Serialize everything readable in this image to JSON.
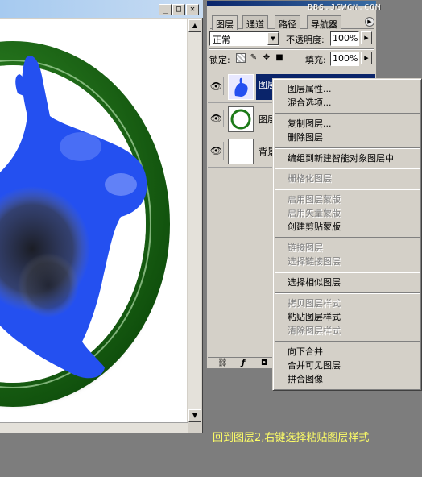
{
  "window_controls": {
    "minimize": "_",
    "maximize": "□",
    "close": "✕"
  },
  "watermark": "BBS.JCWCN.COM",
  "palette": {
    "tabs": [
      {
        "label": "图层",
        "active": true
      },
      {
        "label": "通道",
        "active": false
      },
      {
        "label": "路径",
        "active": false
      },
      {
        "label": "导航器",
        "active": false
      }
    ],
    "blend_mode": "正常",
    "opacity_label": "不透明度:",
    "opacity_value": "100%",
    "lock_label": "锁定:",
    "fill_label": "填充:",
    "fill_value": "100%",
    "layers": [
      {
        "name": "图层",
        "visible_icon": "eye-icon",
        "thumb": "rabbit-thumb",
        "selected": true
      },
      {
        "name": "图层",
        "visible_icon": "eye-icon",
        "thumb": "ring-thumb",
        "selected": false
      },
      {
        "name": "背景",
        "visible_icon": "eye-icon",
        "thumb": "white-thumb",
        "selected": false
      }
    ],
    "footer_icons": [
      "link-icon",
      "layer-style-icon",
      "mask-icon"
    ]
  },
  "context_menu": {
    "items": [
      {
        "label": "图层属性...",
        "enabled": true
      },
      {
        "label": "混合选项...",
        "enabled": true
      },
      {
        "label": "复制图层...",
        "enabled": true
      },
      {
        "label": "删除图层",
        "enabled": true
      },
      {
        "label": "编组到新建智能对象图层中",
        "enabled": true
      },
      {
        "label": "栅格化图层",
        "enabled": false
      },
      {
        "label": "启用图层蒙版",
        "enabled": false
      },
      {
        "label": "启用矢量蒙版",
        "enabled": false
      },
      {
        "label": "创建剪贴蒙版",
        "enabled": true
      },
      {
        "label": "链接图层",
        "enabled": false
      },
      {
        "label": "选择链接图层",
        "enabled": false
      },
      {
        "label": "选择相似图层",
        "enabled": true
      },
      {
        "label": "拷贝图层样式",
        "enabled": false
      },
      {
        "label": "粘贴图层样式",
        "enabled": true
      },
      {
        "label": "清除图层样式",
        "enabled": false
      },
      {
        "label": "向下合并",
        "enabled": true
      },
      {
        "label": "合并可见图层",
        "enabled": true
      },
      {
        "label": "拼合图像",
        "enabled": true
      }
    ]
  },
  "caption": "回到图层2,右键选择粘贴图层样式",
  "colors": {
    "rabbit": "#2450f0",
    "ring": "#1d7a18",
    "selection": "#0a246a",
    "caption": "#ffff66",
    "background": "#7d7d7d"
  }
}
